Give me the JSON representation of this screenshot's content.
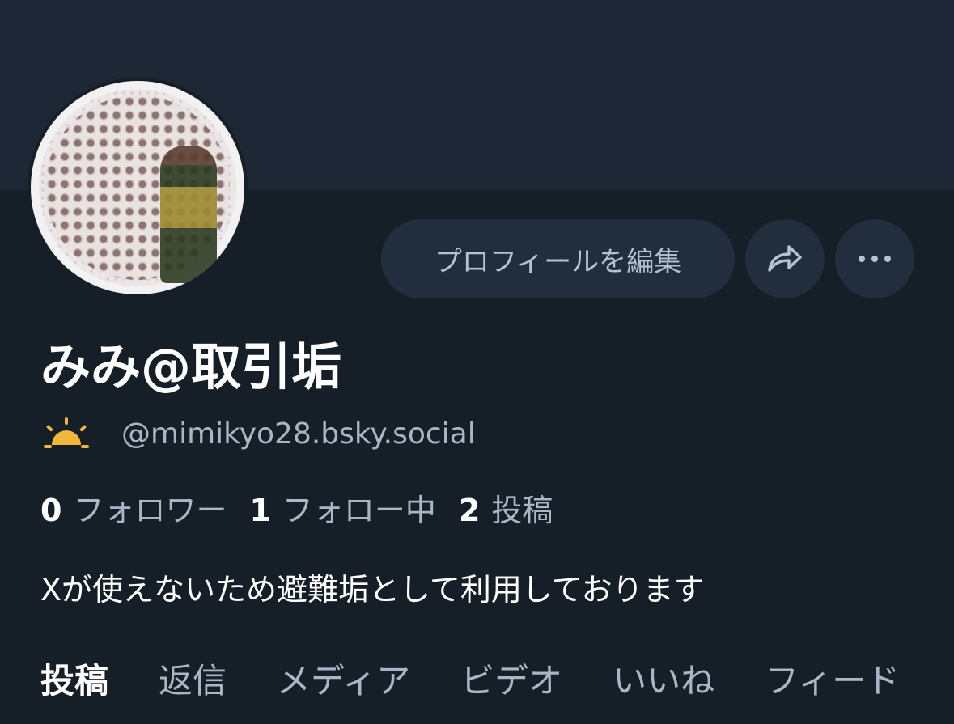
{
  "profile": {
    "display_name": "みみ@取引垢",
    "handle": "@mimikyo28.bsky.social",
    "bio": "Xが使えないため避難垢として利用しております"
  },
  "actions": {
    "edit_profile_label": "プロフィールを編集",
    "share_icon": "share-arrow-icon",
    "more_icon": "more-horizontal-icon"
  },
  "badge": {
    "icon": "sun-icon",
    "color": "#f1b63c"
  },
  "stats": [
    {
      "count": "0",
      "label": "フォロワー"
    },
    {
      "count": "1",
      "label": "フォロー中"
    },
    {
      "count": "2",
      "label": "投稿"
    }
  ],
  "tabs": [
    {
      "label": "投稿",
      "active": true
    },
    {
      "label": "返信",
      "active": false
    },
    {
      "label": "メディア",
      "active": false
    },
    {
      "label": "ビデオ",
      "active": false
    },
    {
      "label": "いいね",
      "active": false
    },
    {
      "label": "フィード",
      "active": false
    }
  ],
  "colors": {
    "background": "#161e27",
    "banner": "#1e2735",
    "button_bg": "#222d3d",
    "muted_text": "#a9b6c6"
  }
}
